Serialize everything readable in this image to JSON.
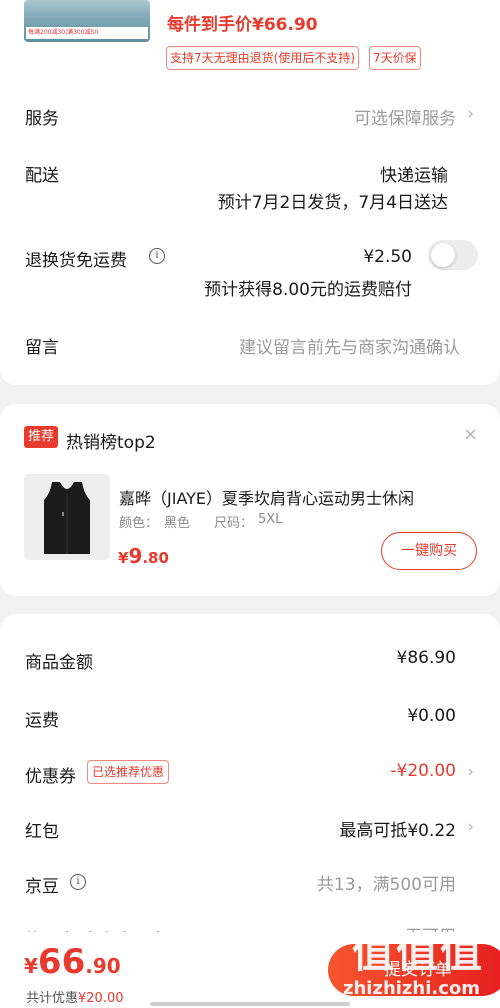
{
  "top": {
    "thumb_promo": "每满200减30|满300减50",
    "price_each": "每件到手价¥66.90",
    "tags": [
      "支持7天无理由退货(使用后不支持)",
      "7天价保"
    ]
  },
  "rows": {
    "service": {
      "label": "服务",
      "value": "可选保障服务"
    },
    "delivery": {
      "label": "配送",
      "method": "快递运输",
      "eta": "预计7月2日发货，7月4日送达"
    },
    "return_free": {
      "label": "退换货免运费",
      "price": "¥2.50",
      "note": "预计获得8.00元的运费赔付",
      "toggle_on": false
    },
    "message": {
      "label": "留言",
      "placeholder": "建议留言前先与商家沟通确认"
    }
  },
  "recommend": {
    "badge": "推荐",
    "title": "热销榜top2",
    "close": "×",
    "product": {
      "name": "嘉晔（JIAYE）夏季坎肩背心运动男士休闲",
      "color_label": "颜色：",
      "color_value": "黑色",
      "size_label": "尺码：",
      "size_value": "5XL",
      "price_currency": "¥",
      "price_int": "9",
      "price_dec": ".80",
      "buy_label": "一键购买"
    }
  },
  "summary": {
    "goods": {
      "label": "商品金额",
      "value": "¥86.90"
    },
    "shipping": {
      "label": "运费",
      "value": "¥0.00"
    },
    "coupon": {
      "label": "优惠券",
      "tag": "已选推荐优惠",
      "value": "-¥20.00"
    },
    "redpack": {
      "label": "红包",
      "value": "最高可抵¥0.22"
    },
    "jd_bean": {
      "label": "京豆",
      "value": "共13，满500可用"
    },
    "gift_card": {
      "label": "礼品卡(京东卡/E卡)",
      "value": "无可用"
    }
  },
  "bottom": {
    "total_currency": "¥",
    "total_int": "66",
    "total_dec": ".90",
    "discount_label": "共计优惠",
    "discount_value": "¥20.00",
    "submit_label": "提交订单"
  },
  "watermark": {
    "glyphs": "值值值",
    "text": "zhizhizhi.com"
  },
  "colors": {
    "accent": "#e93b2d",
    "muted": "#9b9b9b",
    "background": "#f2f2f2"
  }
}
